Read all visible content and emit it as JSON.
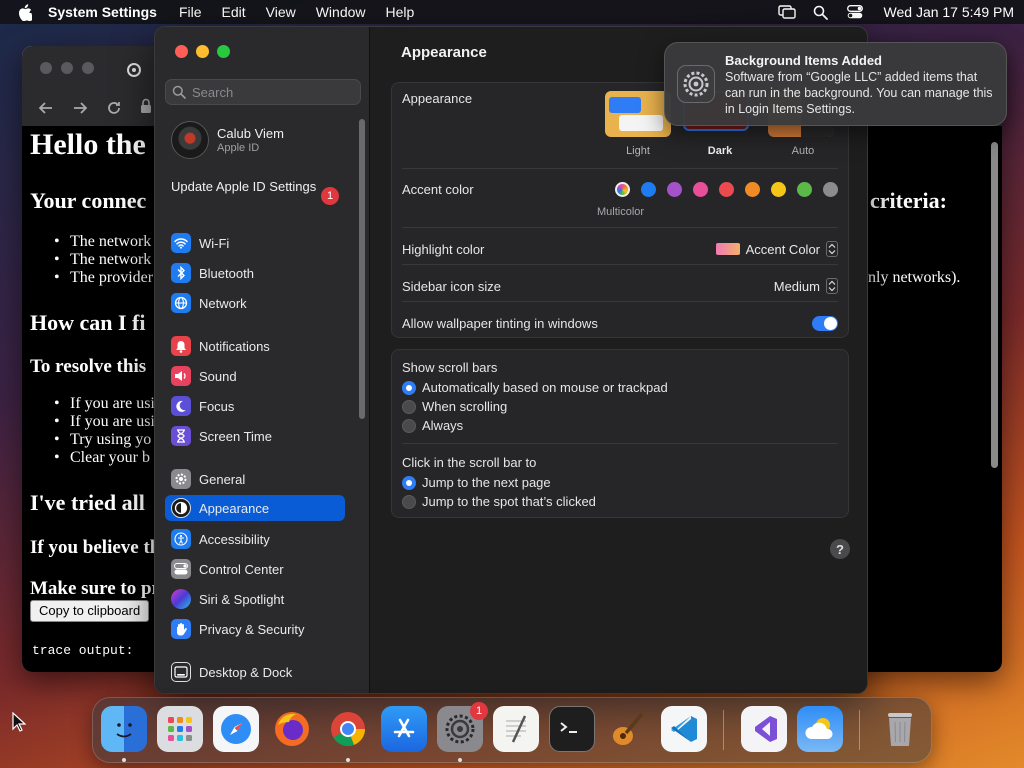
{
  "menubar": {
    "app_name": "System Settings",
    "menus": [
      "File",
      "Edit",
      "View",
      "Window",
      "Help"
    ],
    "clock": "Wed Jan 17  5:49 PM"
  },
  "browser_page": {
    "h1": "Hello the",
    "h2_connection": "Your connec",
    "criteria_fragment": "criteria:",
    "bullets_1": [
      "The network",
      "The network",
      "The provider"
    ],
    "networks_fragment": "nly networks).",
    "h2_fix": "How can I fi",
    "h3_resolve": "To resolve this",
    "bullets_2": [
      "If you are usi",
      "If you are usi",
      "Try using yo",
      "Clear your b"
    ],
    "h2_tried": "I've tried all",
    "h3_believe": "If you believe th",
    "h3_make_sure": "Make sure to pr",
    "copy_button": "Copy to clipboard",
    "trace": "trace output:"
  },
  "sidebar": {
    "search_placeholder": "Search",
    "account_name": "Calub Viem",
    "account_sub": "Apple ID",
    "update_label": "Update Apple ID Settings",
    "update_badge": "1",
    "items": [
      {
        "label": "Wi-Fi",
        "color": "#1f7cf0"
      },
      {
        "label": "Bluetooth",
        "color": "#1f7cf0"
      },
      {
        "label": "Network",
        "color": "#1f7cf0"
      },
      {
        "label": "Notifications",
        "color": "#e8434a"
      },
      {
        "label": "Sound",
        "color": "#e8435e"
      },
      {
        "label": "Focus",
        "color": "#5b4fd6"
      },
      {
        "label": "Screen Time",
        "color": "#6a4fd6"
      },
      {
        "label": "General",
        "color": "#8a8a8e"
      },
      {
        "label": "Appearance",
        "color": "#1a1a1a"
      },
      {
        "label": "Accessibility",
        "color": "#1f7cf0"
      },
      {
        "label": "Control Center",
        "color": "#8a8a8e"
      },
      {
        "label": "Siri & Spotlight",
        "color": "#b046c8"
      },
      {
        "label": "Privacy & Security",
        "color": "#2f7df6"
      },
      {
        "label": "Desktop & Dock",
        "color": "#2a2a2c"
      }
    ],
    "selected": "Appearance"
  },
  "content": {
    "title": "Appearance",
    "appearance_label": "Appearance",
    "themes": [
      "Light",
      "Dark",
      "Auto"
    ],
    "selected_theme": "Dark",
    "accent_label": "Accent color",
    "accent_colors": [
      "#c8c8c8",
      "#1f7cf0",
      "#a452c9",
      "#e94f98",
      "#ec4a4f",
      "#f08a24",
      "#f5c518",
      "#5bb94a",
      "#8c8c8c"
    ],
    "multicolor_label": "Multicolor",
    "highlight_label": "Highlight color",
    "highlight_value": "Accent Color",
    "sidebar_icon_label": "Sidebar icon size",
    "sidebar_icon_value": "Medium",
    "wallpaper_tint_label": "Allow wallpaper tinting in windows",
    "scroll_bars_label": "Show scroll bars",
    "scroll_options": [
      "Automatically based on mouse or trackpad",
      "When scrolling",
      "Always"
    ],
    "click_label": "Click in the scroll bar to",
    "click_options": [
      "Jump to the next page",
      "Jump to the spot that’s clicked"
    ],
    "help": "?"
  },
  "notification": {
    "title": "Background Items Added",
    "body": "Software from “Google LLC” added items that can run in the background. You can manage this in Login Items Settings."
  },
  "dock": {
    "apps": [
      "finder",
      "launchpad",
      "safari",
      "firefox",
      "chrome",
      "app-store",
      "system-settings",
      "textedit",
      "terminal",
      "garageband",
      "vscode",
      "visual-studio",
      "weather",
      "trash"
    ],
    "settings_badge": "1"
  }
}
